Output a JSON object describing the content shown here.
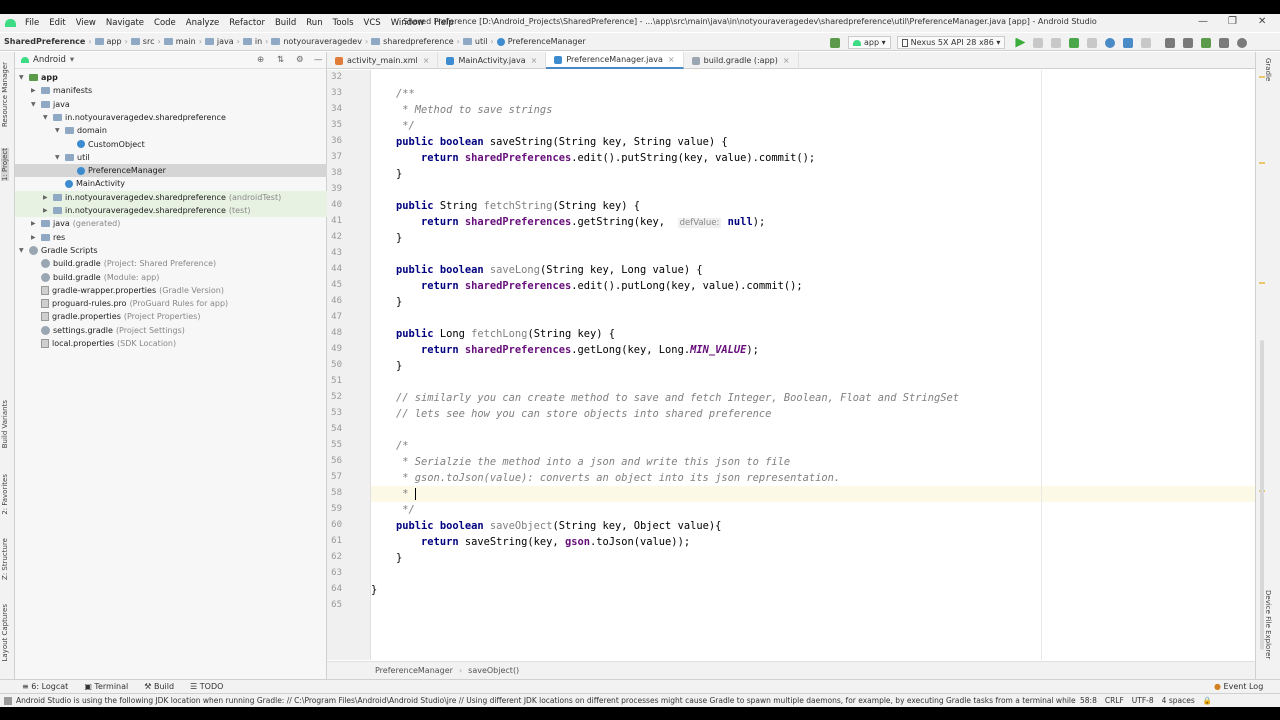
{
  "menu": [
    "File",
    "Edit",
    "View",
    "Navigate",
    "Code",
    "Analyze",
    "Refactor",
    "Build",
    "Run",
    "Tools",
    "VCS",
    "Window",
    "Help"
  ],
  "window_title": "Shared Preference [D:\\Android_Projects\\SharedPreference] - ...\\app\\src\\main\\java\\in\\notyouraveragedev\\sharedpreference\\util\\PreferenceManager.java [app] - Android Studio",
  "breadcrumb": [
    "SharedPreference",
    "app",
    "src",
    "main",
    "java",
    "in",
    "notyouraveragedev",
    "sharedpreference",
    "util",
    "PreferenceManager"
  ],
  "run_config": "app",
  "device": "Nexus 5X API 28 x86",
  "project_view": "Android",
  "left_tabs": [
    "Resource Manager",
    "1: Project",
    "Build Variants",
    "2: Favorites",
    "Z: Structure",
    "Layout Captures"
  ],
  "right_tabs": [
    "Gradle",
    "Device File Explorer"
  ],
  "tree": [
    {
      "label": "app",
      "gray": "",
      "depth": 0,
      "arrow": "▼",
      "icon": "folder",
      "bold": true
    },
    {
      "label": "manifests",
      "gray": "",
      "depth": 1,
      "arrow": "▶",
      "icon": "folder"
    },
    {
      "label": "java",
      "gray": "",
      "depth": 1,
      "arrow": "▼",
      "icon": "folder"
    },
    {
      "label": "in.notyouraveragedev.sharedpreference",
      "gray": "",
      "depth": 2,
      "arrow": "▼",
      "icon": "folder"
    },
    {
      "label": "domain",
      "gray": "",
      "depth": 3,
      "arrow": "▼",
      "icon": "folder"
    },
    {
      "label": "CustomObject",
      "gray": "",
      "depth": 4,
      "arrow": "",
      "icon": "class"
    },
    {
      "label": "util",
      "gray": "",
      "depth": 3,
      "arrow": "▼",
      "icon": "folder"
    },
    {
      "label": "PreferenceManager",
      "gray": "",
      "depth": 4,
      "arrow": "",
      "icon": "class",
      "state": "sel"
    },
    {
      "label": "MainActivity",
      "gray": "",
      "depth": 3,
      "arrow": "",
      "icon": "class"
    },
    {
      "label": "in.notyouraveragedev.sharedpreference",
      "gray": "(androidTest)",
      "depth": 2,
      "arrow": "▶",
      "icon": "folder",
      "state": "green"
    },
    {
      "label": "in.notyouraveragedev.sharedpreference",
      "gray": "(test)",
      "depth": 2,
      "arrow": "▶",
      "icon": "folder",
      "state": "green"
    },
    {
      "label": "java",
      "gray": "(generated)",
      "depth": 1,
      "arrow": "▶",
      "icon": "folder"
    },
    {
      "label": "res",
      "gray": "",
      "depth": 1,
      "arrow": "▶",
      "icon": "folder"
    },
    {
      "label": "Gradle Scripts",
      "gray": "",
      "depth": 0,
      "arrow": "▼",
      "icon": "gradle"
    },
    {
      "label": "build.gradle",
      "gray": "(Project: Shared Preference)",
      "depth": 1,
      "arrow": "",
      "icon": "gradle"
    },
    {
      "label": "build.gradle",
      "gray": "(Module: app)",
      "depth": 1,
      "arrow": "",
      "icon": "gradle"
    },
    {
      "label": "gradle-wrapper.properties",
      "gray": "(Gradle Version)",
      "depth": 1,
      "arrow": "",
      "icon": "file"
    },
    {
      "label": "proguard-rules.pro",
      "gray": "(ProGuard Rules for app)",
      "depth": 1,
      "arrow": "",
      "icon": "file"
    },
    {
      "label": "gradle.properties",
      "gray": "(Project Properties)",
      "depth": 1,
      "arrow": "",
      "icon": "file"
    },
    {
      "label": "settings.gradle",
      "gray": "(Project Settings)",
      "depth": 1,
      "arrow": "",
      "icon": "gradle"
    },
    {
      "label": "local.properties",
      "gray": "(SDK Location)",
      "depth": 1,
      "arrow": "",
      "icon": "file"
    }
  ],
  "tabs": [
    {
      "label": "activity_main.xml",
      "color": "#e07b39",
      "active": false
    },
    {
      "label": "MainActivity.java",
      "color": "#3e8cd0",
      "active": false
    },
    {
      "label": "PreferenceManager.java",
      "color": "#3e8cd0",
      "active": true
    },
    {
      "label": "build.gradle (:app)",
      "color": "#9aa6b2",
      "active": false
    }
  ],
  "code": [
    {
      "n": 32,
      "html": ""
    },
    {
      "n": 33,
      "html": "    <span class=\"cm\">/**</span>"
    },
    {
      "n": 34,
      "html": "     <span class=\"cm\">* Method to save strings</span>"
    },
    {
      "n": 35,
      "html": "     <span class=\"cm\">*/</span>"
    },
    {
      "n": 36,
      "html": "    <span class=\"kw\">public boolean</span> saveString(String key, String value) {"
    },
    {
      "n": 37,
      "html": "        <span class=\"kw\">return</span> <span class=\"fld\">sharedPreferences</span>.edit().putString(key, value).commit();"
    },
    {
      "n": 38,
      "html": "    }"
    },
    {
      "n": 39,
      "html": ""
    },
    {
      "n": 40,
      "html": "    <span class=\"kw\">public</span> String <span class=\"fn\">fetchString</span>(String key) {"
    },
    {
      "n": 41,
      "html": "        <span class=\"kw\">return</span> <span class=\"fld\">sharedPreferences</span>.getString(key,  <span class=\"hint\">defValue:</span> <span class=\"kw\">null</span>);"
    },
    {
      "n": 42,
      "html": "    }"
    },
    {
      "n": 43,
      "html": ""
    },
    {
      "n": 44,
      "html": "    <span class=\"kw\">public boolean</span> <span class=\"fn\">saveLong</span>(String key, Long value) {"
    },
    {
      "n": 45,
      "html": "        <span class=\"kw\">return</span> <span class=\"fld\">sharedPreferences</span>.edit().putLong(key, value).commit();"
    },
    {
      "n": 46,
      "html": "    }"
    },
    {
      "n": 47,
      "html": ""
    },
    {
      "n": 48,
      "html": "    <span class=\"kw\">public</span> Long <span class=\"fn\">fetchLong</span>(String key) {"
    },
    {
      "n": 49,
      "html": "        <span class=\"kw\">return</span> <span class=\"fld\">sharedPreferences</span>.getLong(key, Long.<span class=\"cst\">MIN_VALUE</span>);"
    },
    {
      "n": 50,
      "html": "    }"
    },
    {
      "n": 51,
      "html": ""
    },
    {
      "n": 52,
      "html": "    <span class=\"cm\">// similarly you can create method to save and fetch Integer, Boolean, Float and StringSet</span>"
    },
    {
      "n": 53,
      "html": "    <span class=\"cm\">// lets see how you can store objects into shared preference</span>"
    },
    {
      "n": 54,
      "html": ""
    },
    {
      "n": 55,
      "html": "    <span class=\"cm\">/*</span>"
    },
    {
      "n": 56,
      "html": "     <span class=\"cm\">* Serialzie the method into a json and write this json to file</span>"
    },
    {
      "n": 57,
      "html": "     <span class=\"cm\">* gson.toJson(value): converts an object into its json representation.</span>"
    },
    {
      "n": 58,
      "html": "     <span class=\"cm\">* </span><span class=\"caret\"></span>",
      "cur": true
    },
    {
      "n": 59,
      "html": "     <span class=\"cm\">*/</span>"
    },
    {
      "n": 60,
      "html": "    <span class=\"kw\">public boolean</span> <span class=\"fn\">saveObject</span>(String key, Object value){"
    },
    {
      "n": 61,
      "html": "        <span class=\"kw\">return</span> saveString(key, <span class=\"fld\">gson</span>.toJson(value));"
    },
    {
      "n": 62,
      "html": "    }"
    },
    {
      "n": 63,
      "html": ""
    },
    {
      "n": 64,
      "html": "}"
    },
    {
      "n": 65,
      "html": ""
    }
  ],
  "editor_breadcrumb": [
    "PreferenceManager",
    "saveObject()"
  ],
  "tool_tabs": [
    "6: Logcat",
    "Terminal",
    "Build",
    "TODO"
  ],
  "event_log": "Event Log",
  "status_message": "Android Studio is using the following JDK location when running Gradle: // C:\\Program Files\\Android\\Android Studio\\jre // Using different JDK locations on different processes might cause Gradle to spawn multiple daemons, for example, by executing Gradle tasks from a terminal while us... (10 minutes ago)",
  "status_right": [
    "58:8",
    "CRLF",
    "UTF-8",
    "4 spaces"
  ]
}
